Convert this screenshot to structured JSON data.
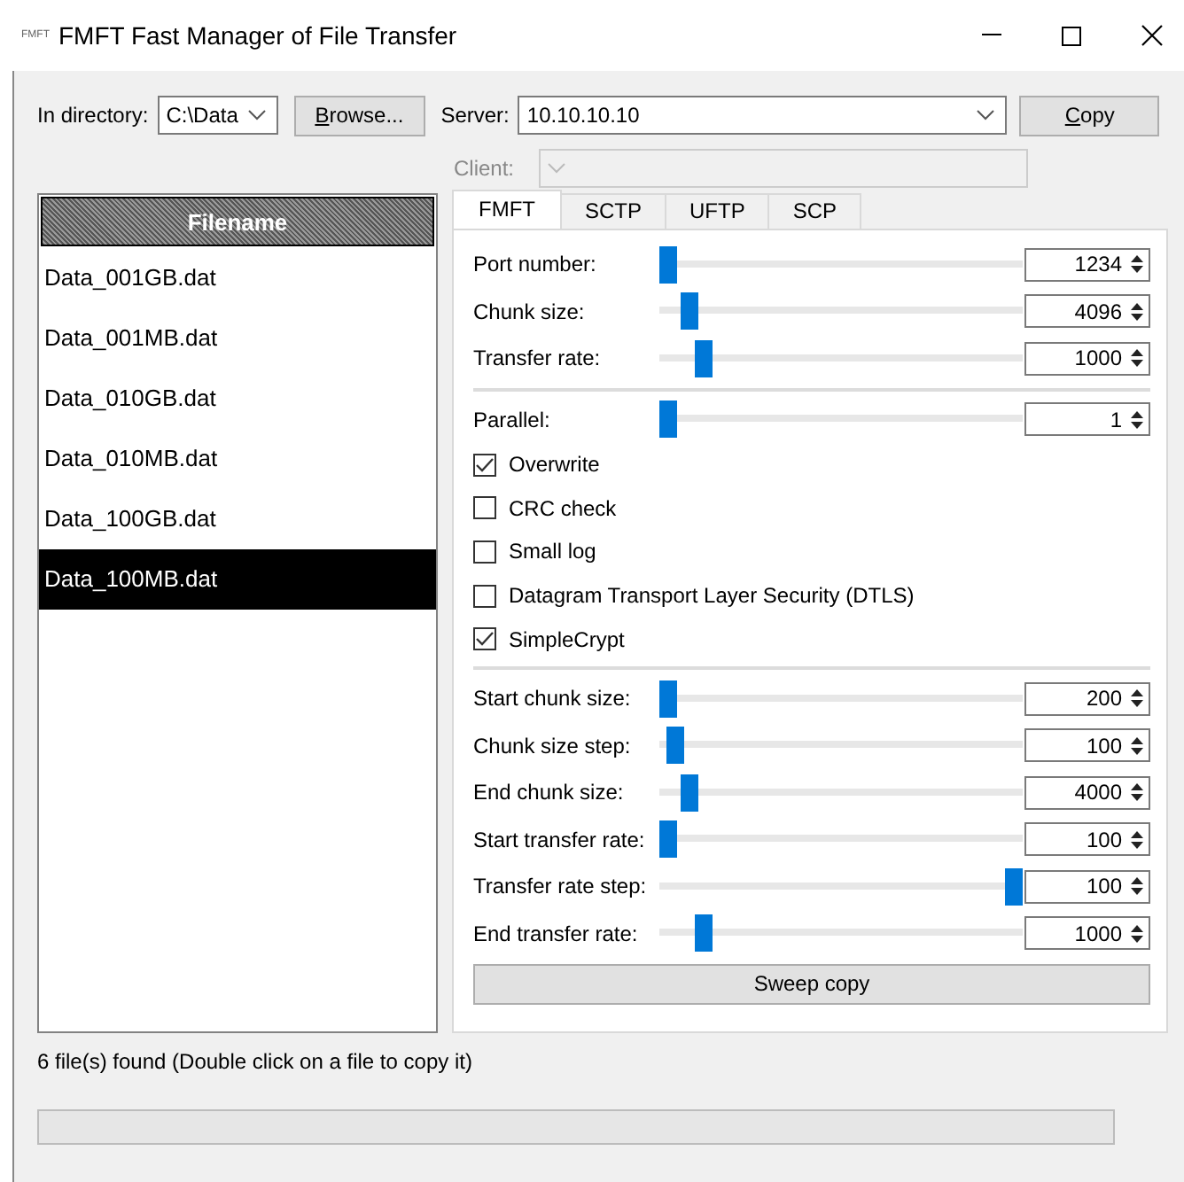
{
  "window": {
    "icon_text": "FMFT",
    "title": "FMFT Fast Manager of File Transfer"
  },
  "directory": {
    "label": "In directory:",
    "value": "C:\\Data"
  },
  "browse_button": {
    "label": "Browse...",
    "access_key_underlined": true
  },
  "server": {
    "label": "Server:",
    "value": "10.10.10.10"
  },
  "copy_button": {
    "label": "Copy",
    "access_key_underlined": true
  },
  "client": {
    "label": "Client:",
    "disabled": true
  },
  "file_list": {
    "header": "Filename",
    "items": [
      {
        "name": "Data_001GB.dat",
        "selected": false
      },
      {
        "name": "Data_001MB.dat",
        "selected": false
      },
      {
        "name": "Data_010GB.dat",
        "selected": false
      },
      {
        "name": "Data_010MB.dat",
        "selected": false
      },
      {
        "name": "Data_100GB.dat",
        "selected": false
      },
      {
        "name": "Data_100MB.dat",
        "selected": true
      }
    ]
  },
  "tabs": [
    {
      "label": "FMFT",
      "selected": true
    },
    {
      "label": "SCTP",
      "selected": false
    },
    {
      "label": "UFTP",
      "selected": false
    },
    {
      "label": "SCP",
      "selected": false
    }
  ],
  "sections": [
    {
      "rows": [
        {
          "kind": "slider",
          "label": "Port number:",
          "level": 0,
          "value": "1234"
        },
        {
          "kind": "slider",
          "label": "Chunk size:",
          "level": 0.06,
          "value": "4096"
        },
        {
          "kind": "slider",
          "label": "Transfer rate:",
          "level": 0.1,
          "value": "1000"
        }
      ]
    },
    {
      "rows": [
        {
          "kind": "slider",
          "label": "Parallel:",
          "level": 0,
          "value": "1"
        },
        {
          "kind": "checkbox",
          "label": "Overwrite",
          "checked": true
        },
        {
          "kind": "checkbox",
          "label": "CRC check",
          "checked": false
        },
        {
          "kind": "checkbox",
          "label": "Small log",
          "checked": false
        },
        {
          "kind": "checkbox",
          "label": "Datagram Transport Layer Security (DTLS)",
          "checked": false
        },
        {
          "kind": "checkbox",
          "label": "SimpleCrypt",
          "checked": true
        }
      ]
    },
    {
      "rows": [
        {
          "kind": "slider",
          "label": "Start chunk size:",
          "level": 0,
          "value": "200"
        },
        {
          "kind": "slider",
          "label": "Chunk size step:",
          "level": 0.02,
          "value": "100"
        },
        {
          "kind": "slider",
          "label": "End chunk size:",
          "level": 0.06,
          "value": "4000"
        },
        {
          "kind": "slider",
          "label": "Start transfer rate:",
          "level": 0,
          "value": "100"
        },
        {
          "kind": "slider",
          "label": "Transfer rate step:",
          "level": 1,
          "value": "100"
        },
        {
          "kind": "slider",
          "label": "End transfer rate:",
          "level": 0.1,
          "value": "1000"
        }
      ]
    }
  ],
  "sweep_button": {
    "label": "Sweep copy"
  },
  "status": "6 file(s) found (Double click on a file to copy it)",
  "progress": {
    "level": 0
  }
}
